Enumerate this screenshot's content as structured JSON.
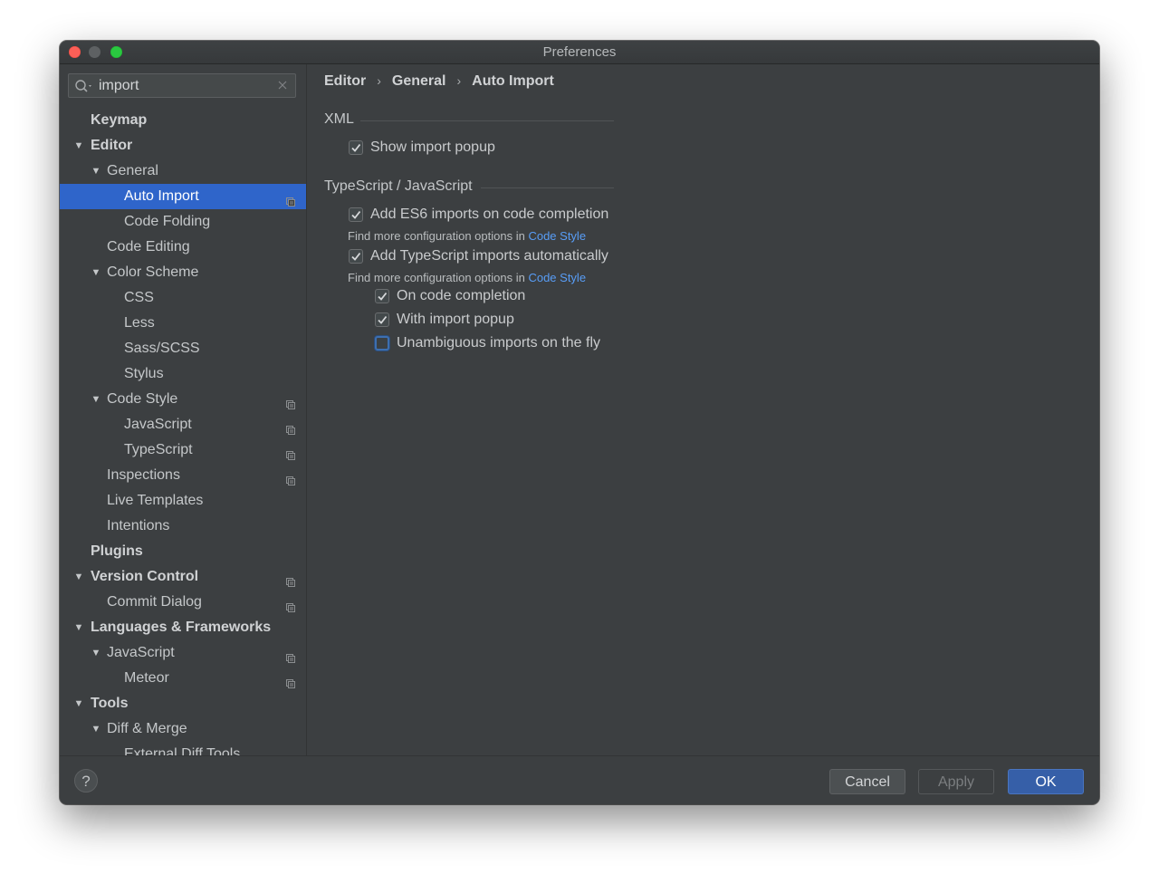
{
  "window": {
    "title": "Preferences"
  },
  "search": {
    "value": "import"
  },
  "sidebar": {
    "items": [
      {
        "label": "Keymap",
        "level": 0,
        "bold": true,
        "arrow": false,
        "badge": false
      },
      {
        "label": "Editor",
        "level": 0,
        "bold": true,
        "arrow": true,
        "badge": false
      },
      {
        "label": "General",
        "level": 1,
        "bold": false,
        "arrow": true,
        "badge": false
      },
      {
        "label": "Auto Import",
        "level": 2,
        "bold": false,
        "arrow": false,
        "badge": true,
        "selected": true
      },
      {
        "label": "Code Folding",
        "level": 2,
        "bold": false,
        "arrow": false,
        "badge": false
      },
      {
        "label": "Code Editing",
        "level": 1,
        "bold": false,
        "arrow": false,
        "badge": false
      },
      {
        "label": "Color Scheme",
        "level": 1,
        "bold": false,
        "arrow": true,
        "badge": false
      },
      {
        "label": "CSS",
        "level": 2,
        "bold": false,
        "arrow": false,
        "badge": false
      },
      {
        "label": "Less",
        "level": 2,
        "bold": false,
        "arrow": false,
        "badge": false
      },
      {
        "label": "Sass/SCSS",
        "level": 2,
        "bold": false,
        "arrow": false,
        "badge": false
      },
      {
        "label": "Stylus",
        "level": 2,
        "bold": false,
        "arrow": false,
        "badge": false
      },
      {
        "label": "Code Style",
        "level": 1,
        "bold": false,
        "arrow": true,
        "badge": true
      },
      {
        "label": "JavaScript",
        "level": 2,
        "bold": false,
        "arrow": false,
        "badge": true
      },
      {
        "label": "TypeScript",
        "level": 2,
        "bold": false,
        "arrow": false,
        "badge": true
      },
      {
        "label": "Inspections",
        "level": 1,
        "bold": false,
        "arrow": false,
        "badge": true
      },
      {
        "label": "Live Templates",
        "level": 1,
        "bold": false,
        "arrow": false,
        "badge": false
      },
      {
        "label": "Intentions",
        "level": 1,
        "bold": false,
        "arrow": false,
        "badge": false
      },
      {
        "label": "Plugins",
        "level": 0,
        "bold": true,
        "arrow": false,
        "badge": false
      },
      {
        "label": "Version Control",
        "level": 0,
        "bold": true,
        "arrow": true,
        "badge": true
      },
      {
        "label": "Commit Dialog",
        "level": 1,
        "bold": false,
        "arrow": false,
        "badge": true
      },
      {
        "label": "Languages & Frameworks",
        "level": 0,
        "bold": true,
        "arrow": true,
        "badge": false
      },
      {
        "label": "JavaScript",
        "level": 1,
        "bold": false,
        "arrow": true,
        "badge": true
      },
      {
        "label": "Meteor",
        "level": 2,
        "bold": false,
        "arrow": false,
        "badge": true
      },
      {
        "label": "Tools",
        "level": 0,
        "bold": true,
        "arrow": true,
        "badge": false
      },
      {
        "label": "Diff & Merge",
        "level": 1,
        "bold": false,
        "arrow": true,
        "badge": false
      },
      {
        "label": "External Diff Tools",
        "level": 2,
        "bold": false,
        "arrow": false,
        "badge": false
      }
    ]
  },
  "breadcrumb": [
    "Editor",
    "General",
    "Auto Import"
  ],
  "breadcrumb_separator": "›",
  "xml": {
    "title": "XML",
    "show_import_popup": {
      "label": "Show import popup",
      "checked": true
    }
  },
  "ts": {
    "title": "TypeScript / JavaScript",
    "add_es6": {
      "label": "Add ES6 imports on code completion",
      "checked": true
    },
    "hint1_prefix": "Find more configuration options in ",
    "hint1_link": "Code Style",
    "add_ts": {
      "label": "Add TypeScript imports automatically",
      "checked": true
    },
    "hint2_prefix": "Find more configuration options in ",
    "hint2_link": "Code Style",
    "on_completion": {
      "label": "On code completion",
      "checked": true
    },
    "with_popup": {
      "label": "With import popup",
      "checked": true
    },
    "unambiguous": {
      "label": "Unambiguous imports on the fly",
      "checked": false
    }
  },
  "footer": {
    "help_label": "?",
    "cancel_label": "Cancel",
    "apply_label": "Apply",
    "ok_label": "OK"
  },
  "colors": {
    "selection": "#2f65ca",
    "link": "#589df6",
    "ok_button": "#365fa8"
  }
}
